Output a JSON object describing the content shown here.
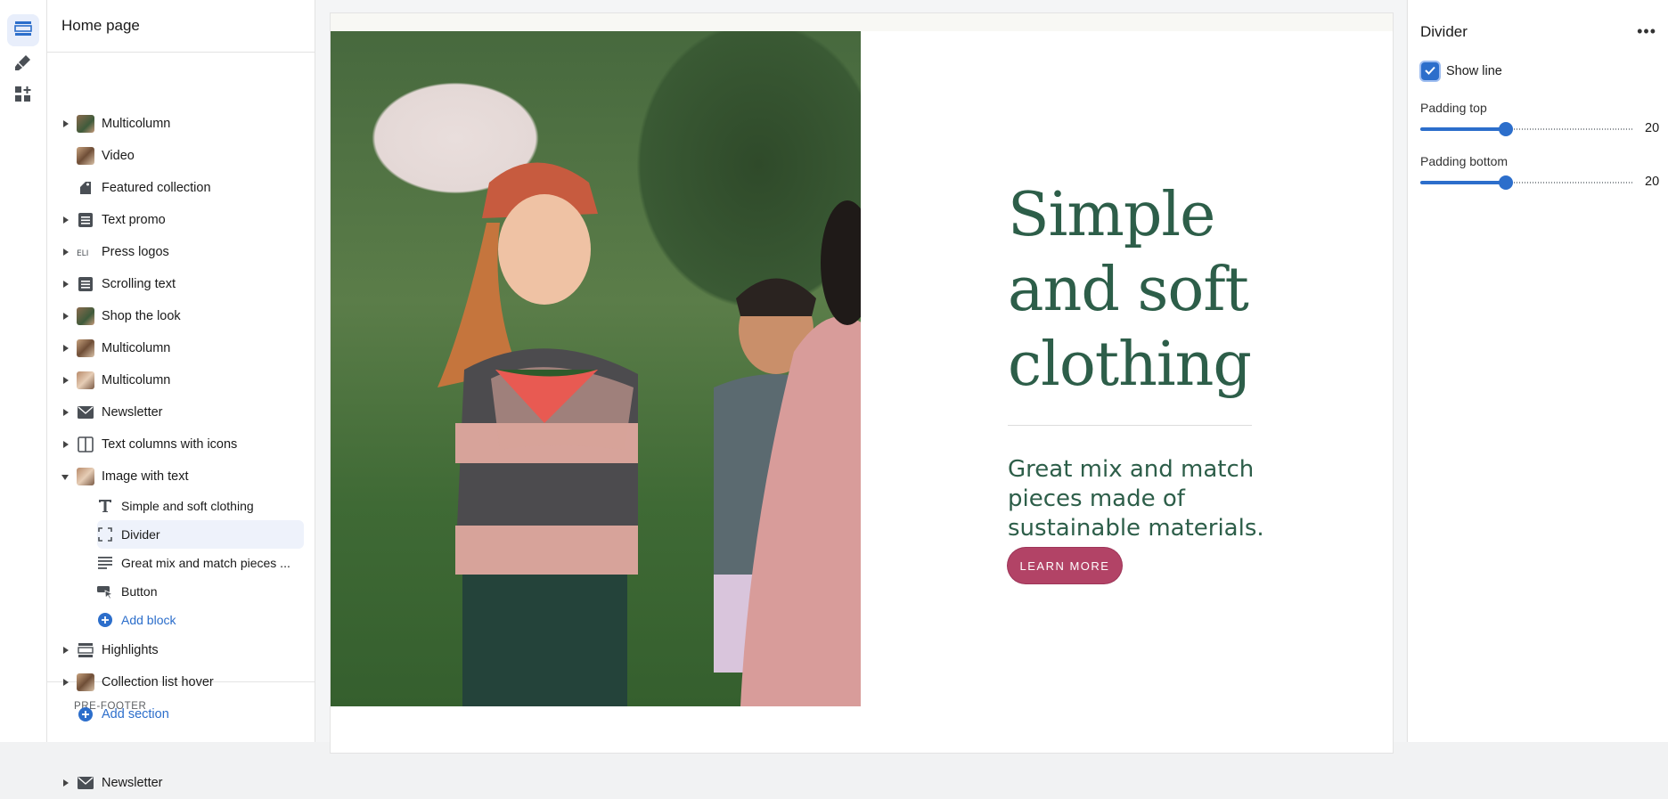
{
  "panel": {
    "title": "Home page",
    "sections": [
      {
        "label": "Multicolumn",
        "caret": "right",
        "icon": "image-thumb-icon"
      },
      {
        "label": "Video",
        "caret": "none",
        "icon": "image-thumb-icon"
      },
      {
        "label": "Featured collection",
        "caret": "none",
        "icon": "tag-icon"
      },
      {
        "label": "Text promo",
        "caret": "right",
        "icon": "text-block-icon"
      },
      {
        "label": "Press logos",
        "caret": "right",
        "icon": "logo-thumb-icon"
      },
      {
        "label": "Scrolling text",
        "caret": "right",
        "icon": "text-block-icon"
      },
      {
        "label": "Shop the look",
        "caret": "right",
        "icon": "image-thumb-icon"
      },
      {
        "label": "Multicolumn",
        "caret": "right",
        "icon": "image-thumb-icon"
      },
      {
        "label": "Multicolumn",
        "caret": "right",
        "icon": "image-thumb-icon"
      },
      {
        "label": "Newsletter",
        "caret": "right",
        "icon": "envelope-icon"
      },
      {
        "label": "Text columns with icons",
        "caret": "right",
        "icon": "columns-icon"
      },
      {
        "label": "Image with text",
        "caret": "down",
        "icon": "image-thumb-icon"
      }
    ],
    "blocks": [
      {
        "label": "Simple and soft clothing",
        "icon": "heading-icon"
      },
      {
        "label": "Divider",
        "icon": "divider-icon",
        "selected": true
      },
      {
        "label": "Great mix and match pieces ...",
        "icon": "paragraph-icon"
      },
      {
        "label": "Button",
        "icon": "button-icon"
      }
    ],
    "add_block": "Add block",
    "after_sections": [
      {
        "label": "Highlights",
        "caret": "right",
        "icon": "highlights-icon"
      },
      {
        "label": "Collection list hover",
        "caret": "right",
        "icon": "image-thumb-icon"
      }
    ],
    "add_section": "Add section",
    "prefooter_label": "PRE-FOOTER",
    "prefooter_sections": [
      {
        "label": "Newsletter",
        "caret": "right",
        "icon": "envelope-icon"
      }
    ]
  },
  "preview": {
    "heading": "Simple and soft clothing",
    "paragraph": "Great mix and match pieces made of sustainable materials.",
    "button": "LEARN MORE",
    "heading_color": "#2d5e49",
    "button_color": "#b24366"
  },
  "settings": {
    "title": "Divider",
    "more_icon": "more-horizontal-icon",
    "show_line_label": "Show line",
    "show_line_checked": true,
    "padding_top_label": "Padding top",
    "padding_top_value": "20",
    "padding_top_fraction": 0.4,
    "padding_bottom_label": "Padding bottom",
    "padding_bottom_value": "20",
    "padding_bottom_fraction": 0.4
  },
  "colors": {
    "accent": "#2c6ecb"
  }
}
